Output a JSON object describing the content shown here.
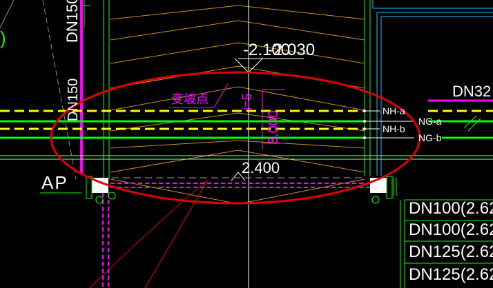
{
  "drawing": {
    "background": "#000000",
    "colors": {
      "green": "#00FF00",
      "magenta": "#FF00FF",
      "yellow": "#FFFF00",
      "red": "#FF0000",
      "orange": "#FFA500",
      "white": "#FFFFFF",
      "cyan": "#00CCFF"
    },
    "labels": {
      "dn150_upper": "DN150",
      "dn150_lower": "DN150",
      "elev_top": "-2.100",
      "elev_top_overlap": "-2.030",
      "slope_change": "变坡点",
      "slope_dim": "i=5",
      "slope_dim2": "3.000",
      "elev_bottom": "2.400",
      "dn32": "DN32",
      "ap": "AP",
      "paren": ")"
    },
    "pipes": [
      {
        "name": "NH-a"
      },
      {
        "name": "NG-a"
      },
      {
        "name": "NH-b"
      },
      {
        "name": "NG-b"
      }
    ],
    "pipe_table": [
      "DN100(2.62",
      "DN100(2.62",
      "DN125(2.62",
      "DN125(2.62"
    ]
  }
}
